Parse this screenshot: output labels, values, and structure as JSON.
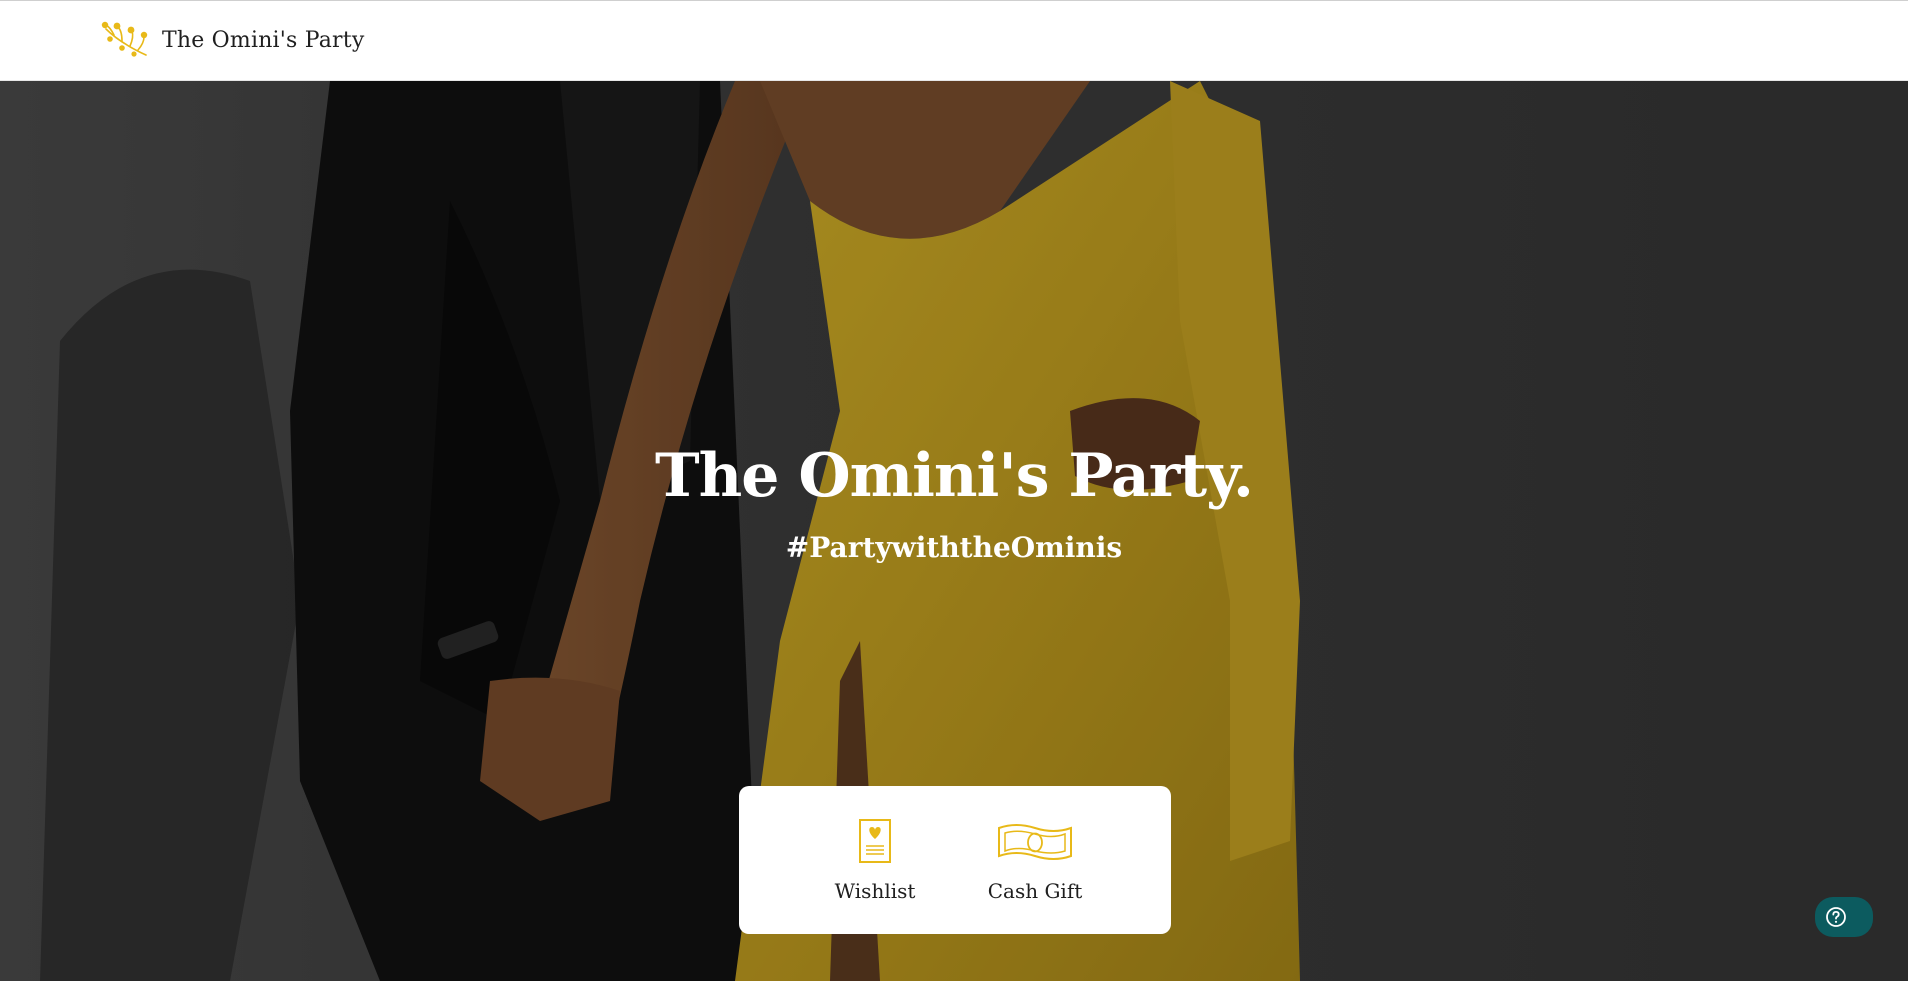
{
  "header": {
    "brand_name": "The Omini's Party",
    "logo_icon": "golden-flower-sprig-icon"
  },
  "hero": {
    "title": "The Omini's Party.",
    "hashtag": "#PartywiththeOminis",
    "image": "couple-portrait-photo"
  },
  "gift_options": [
    {
      "label": "Wishlist",
      "icon": "wishlist-card-heart-icon"
    },
    {
      "label": "Cash Gift",
      "icon": "banknote-icon"
    }
  ],
  "help": {
    "icon": "question-mark-icon"
  },
  "colors": {
    "accent_gold": "#E8B918",
    "dress_yellow": "#C9A825",
    "help_button": "#0C5B5F",
    "header_bg": "#FFFFFF",
    "backdrop": "#3A3A3A"
  }
}
